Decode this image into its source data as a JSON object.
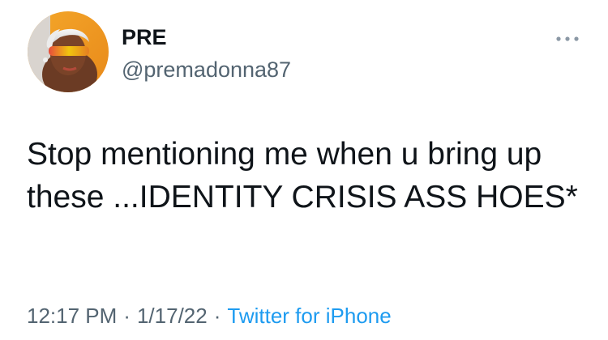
{
  "author": {
    "display_name": "PRE",
    "handle": "@premadonna87",
    "avatar_icon": "profile-avatar"
  },
  "tweet": {
    "text": "Stop mentioning me when u bring up these ...IDENTITY CRISIS ASS HOES*"
  },
  "meta": {
    "time": "12:17 PM",
    "date": "1/17/22",
    "separator": "·",
    "source": "Twitter for iPhone"
  },
  "menu": {
    "icon": "more-options-icon"
  },
  "colors": {
    "text_primary": "#0f1419",
    "text_secondary": "#536471",
    "link": "#1d9bf0",
    "background": "#ffffff"
  }
}
